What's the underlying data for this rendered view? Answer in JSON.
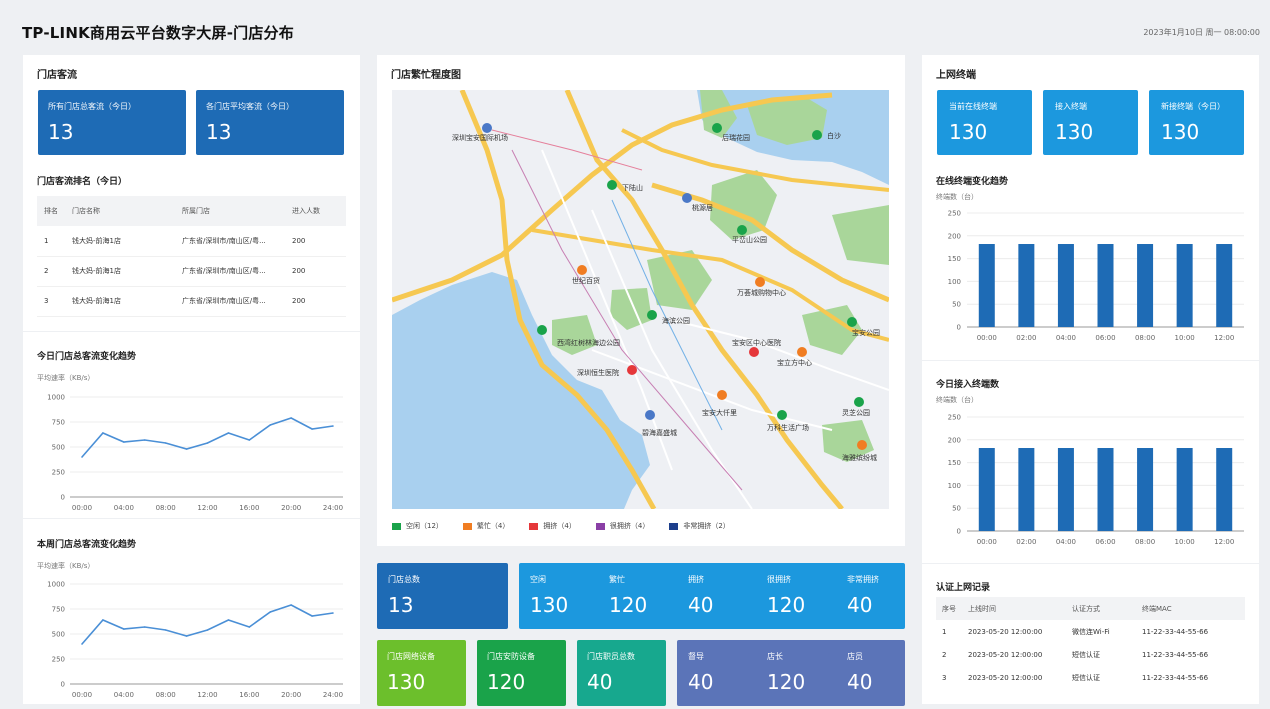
{
  "header": {
    "title": "TP-LINK商用云平台数字大屏-门店分布",
    "datetime": "2023年1月10日 周一 08:00:00"
  },
  "traffic": {
    "title": "门店客流",
    "cards": [
      {
        "label": "所有门店总客流（今日）",
        "value": "13"
      },
      {
        "label": "各门店平均客流（今日）",
        "value": "13"
      }
    ]
  },
  "ranking": {
    "title": "门店客流排名（今日）",
    "columns": [
      "排名",
      "门店名称",
      "所属门店",
      "进入人数"
    ],
    "rows": [
      [
        "1",
        "钱大妈-前海1店",
        "广东省/深圳市/南山区/粤...",
        "200"
      ],
      [
        "2",
        "钱大妈-前海1店",
        "广东省/深圳市/南山区/粤...",
        "200"
      ],
      [
        "3",
        "钱大妈-前海1店",
        "广东省/深圳市/南山区/粤...",
        "200"
      ]
    ]
  },
  "today_trend": {
    "title": "今日门店总客流变化趋势",
    "unit": "平均速率（KB/s）",
    "chart_data": {
      "type": "line",
      "x": [
        "00:00",
        "02:00",
        "04:00",
        "06:00",
        "08:00",
        "10:00",
        "12:00",
        "14:00",
        "16:00",
        "18:00",
        "20:00",
        "22:00",
        "24:00"
      ],
      "xticks": [
        "00:00",
        "04:00",
        "08:00",
        "12:00",
        "16:00",
        "20:00",
        "24:00"
      ],
      "yticks": [
        0,
        250,
        500,
        750,
        1000
      ],
      "ylim": [
        0,
        1000
      ],
      "values": [
        400,
        640,
        550,
        570,
        540,
        480,
        540,
        640,
        570,
        720,
        790,
        680,
        710
      ],
      "color": "#4a8fd6"
    }
  },
  "week_trend": {
    "title": "本周门店总客流变化趋势",
    "unit": "平均速率（KB/s）",
    "chart_data": {
      "type": "line",
      "x": [
        "00:00",
        "02:00",
        "04:00",
        "06:00",
        "08:00",
        "10:00",
        "12:00",
        "14:00",
        "16:00",
        "18:00",
        "20:00",
        "22:00",
        "24:00"
      ],
      "xticks": [
        "00:00",
        "04:00",
        "08:00",
        "12:00",
        "16:00",
        "20:00",
        "24:00"
      ],
      "yticks": [
        0,
        250,
        500,
        750,
        1000
      ],
      "ylim": [
        0,
        1000
      ],
      "values": [
        400,
        640,
        550,
        570,
        540,
        480,
        540,
        640,
        570,
        720,
        790,
        680,
        710
      ],
      "color": "#4a8fd6"
    }
  },
  "map": {
    "title": "门店繁忙程度图",
    "labels": [
      "深圳宝安国际机场",
      "后瑞花园",
      "下陆山",
      "白沙",
      "桃源居",
      "平峦山公园",
      "世纪百货",
      "万荟城购物中心",
      "海滨公园",
      "西湾红树林海边公园",
      "宝安区中心医院",
      "宝立方中心",
      "宝安公园",
      "深圳恒生医院",
      "宝安大仟里",
      "灵芝公园",
      "碧海嘉盛城",
      "万科生活广场",
      "海雅缤纷城"
    ],
    "legend": [
      {
        "label": "空闲（12）",
        "color": "#1aa34a"
      },
      {
        "label": "繁忙（4）",
        "color": "#f07d22"
      },
      {
        "label": "拥挤（4）",
        "color": "#e5373a"
      },
      {
        "label": "很拥挤（4）",
        "color": "#8a3fa6"
      },
      {
        "label": "非常拥挤（2）",
        "color": "#1d3f8c"
      }
    ]
  },
  "store_stats": {
    "total": {
      "label": "门店总数",
      "value": "13"
    },
    "status": [
      {
        "label": "空闲",
        "value": "130"
      },
      {
        "label": "繁忙",
        "value": "120"
      },
      {
        "label": "拥挤",
        "value": "40"
      },
      {
        "label": "很拥挤",
        "value": "120"
      },
      {
        "label": "非常拥挤",
        "value": "40"
      }
    ],
    "network": {
      "label": "门店网络设备",
      "value": "130"
    },
    "security": {
      "label": "门店安防设备",
      "value": "120"
    },
    "staff": {
      "label": "门店职员总数",
      "value": "40"
    },
    "roles": [
      {
        "label": "督导",
        "value": "40"
      },
      {
        "label": "店长",
        "value": "120"
      },
      {
        "label": "店员",
        "value": "40"
      }
    ]
  },
  "terminals": {
    "title": "上网终端",
    "cards": [
      {
        "label": "当前在线终端",
        "value": "130"
      },
      {
        "label": "接入终端",
        "value": "130"
      },
      {
        "label": "新接终端（今日）",
        "value": "130"
      }
    ]
  },
  "online_trend": {
    "title": "在线终端变化趋势",
    "unit": "终端数（台）",
    "chart_data": {
      "type": "bar",
      "categories": [
        "00:00",
        "02:00",
        "04:00",
        "06:00",
        "08:00",
        "10:00",
        "12:00"
      ],
      "values": [
        182,
        182,
        182,
        182,
        182,
        182,
        182
      ],
      "yticks": [
        0,
        50,
        100,
        150,
        200,
        250
      ],
      "ylim": [
        0,
        250
      ],
      "color": "#1e6bb5"
    }
  },
  "today_access": {
    "title": "今日接入终端数",
    "unit": "终端数（台）",
    "chart_data": {
      "type": "bar",
      "categories": [
        "00:00",
        "02:00",
        "04:00",
        "06:00",
        "08:00",
        "10:00",
        "12:00"
      ],
      "values": [
        182,
        182,
        182,
        182,
        182,
        182,
        182
      ],
      "yticks": [
        0,
        50,
        100,
        150,
        200,
        250
      ],
      "ylim": [
        0,
        250
      ],
      "color": "#1e6bb5"
    }
  },
  "auth_records": {
    "title": "认证上网记录",
    "columns": [
      "序号",
      "上线时间",
      "认证方式",
      "终端MAC"
    ],
    "rows": [
      [
        "1",
        "2023-05-20 12:00:00",
        "微信连Wi-Fi",
        "11-22-33-44-55-66"
      ],
      [
        "2",
        "2023-05-20 12:00:00",
        "短信认证",
        "11-22-33-44-55-66"
      ],
      [
        "3",
        "2023-05-20 12:00:00",
        "短信认证",
        "11-22-33-44-55-66"
      ]
    ]
  }
}
